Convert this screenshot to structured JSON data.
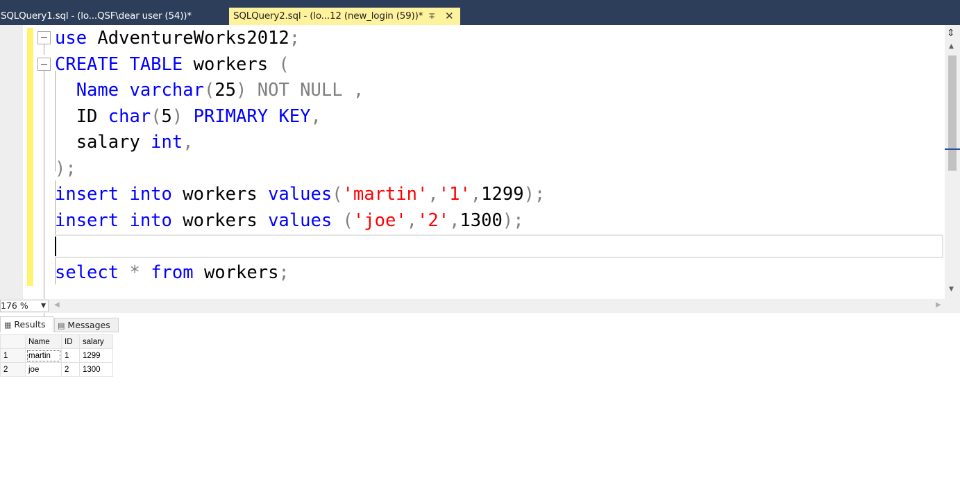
{
  "tabs": [
    {
      "label": "SQLQuery1.sql - (lo...QSF\\dear user (54))*",
      "active": false
    },
    {
      "label": "SQLQuery2.sql - (lo...12 (new_login (59))*",
      "active": true
    }
  ],
  "tab_icons": {
    "pin": "pin-icon",
    "close": "close-icon"
  },
  "editor": {
    "lines": [
      [
        {
          "t": "use ",
          "c": "kw"
        },
        {
          "t": "AdventureWorks2012",
          "c": "id"
        },
        {
          "t": ";",
          "c": "gray"
        }
      ],
      [
        {
          "t": "CREATE ",
          "c": "kw"
        },
        {
          "t": "TABLE ",
          "c": "kw"
        },
        {
          "t": "workers ",
          "c": "id"
        },
        {
          "t": "(",
          "c": "gray"
        }
      ],
      [
        {
          "t": "  Name ",
          "c": "kw"
        },
        {
          "t": "varchar",
          "c": "kw"
        },
        {
          "t": "(",
          "c": "gray"
        },
        {
          "t": "25",
          "c": "id"
        },
        {
          "t": ") ",
          "c": "gray"
        },
        {
          "t": "NOT NULL ,",
          "c": "gray"
        }
      ],
      [
        {
          "t": "  ID ",
          "c": "id"
        },
        {
          "t": "char",
          "c": "kw"
        },
        {
          "t": "(",
          "c": "gray"
        },
        {
          "t": "5",
          "c": "id"
        },
        {
          "t": ") ",
          "c": "gray"
        },
        {
          "t": "PRIMARY KEY",
          "c": "kw"
        },
        {
          "t": ",",
          "c": "gray"
        }
      ],
      [
        {
          "t": "  salary ",
          "c": "id"
        },
        {
          "t": "int",
          "c": "kw"
        },
        {
          "t": ",",
          "c": "gray"
        }
      ],
      [
        {
          "t": ");",
          "c": "gray"
        }
      ],
      [
        {
          "t": "insert ",
          "c": "kw"
        },
        {
          "t": "into ",
          "c": "kw"
        },
        {
          "t": "workers ",
          "c": "id"
        },
        {
          "t": "values",
          "c": "kw"
        },
        {
          "t": "(",
          "c": "gray"
        },
        {
          "t": "'martin'",
          "c": "str"
        },
        {
          "t": ",",
          "c": "gray"
        },
        {
          "t": "'1'",
          "c": "str"
        },
        {
          "t": ",",
          "c": "gray"
        },
        {
          "t": "1299",
          "c": "id"
        },
        {
          "t": ");",
          "c": "gray"
        }
      ],
      [
        {
          "t": "insert ",
          "c": "kw"
        },
        {
          "t": "into ",
          "c": "kw"
        },
        {
          "t": "workers ",
          "c": "id"
        },
        {
          "t": "values ",
          "c": "kw"
        },
        {
          "t": "(",
          "c": "gray"
        },
        {
          "t": "'joe'",
          "c": "str"
        },
        {
          "t": ",",
          "c": "gray"
        },
        {
          "t": "'2'",
          "c": "str"
        },
        {
          "t": ",",
          "c": "gray"
        },
        {
          "t": "1300",
          "c": "id"
        },
        {
          "t": ");",
          "c": "gray"
        }
      ],
      [],
      [
        {
          "t": "select ",
          "c": "kw"
        },
        {
          "t": "* ",
          "c": "gray"
        },
        {
          "t": "from ",
          "c": "kw"
        },
        {
          "t": "workers",
          "c": "id"
        },
        {
          "t": ";",
          "c": "gray"
        }
      ]
    ]
  },
  "zoom": {
    "value": "176 %"
  },
  "results_tabs": [
    {
      "label": "Results",
      "icon": "grid-icon",
      "active": true
    },
    {
      "label": "Messages",
      "icon": "messages-icon",
      "active": false
    }
  ],
  "grid": {
    "columns": [
      "Name",
      "ID",
      "salary"
    ],
    "rows": [
      {
        "num": "1",
        "cells": [
          "martin",
          "1",
          "1299"
        ]
      },
      {
        "num": "2",
        "cells": [
          "joe",
          "2",
          "1300"
        ]
      }
    ]
  }
}
